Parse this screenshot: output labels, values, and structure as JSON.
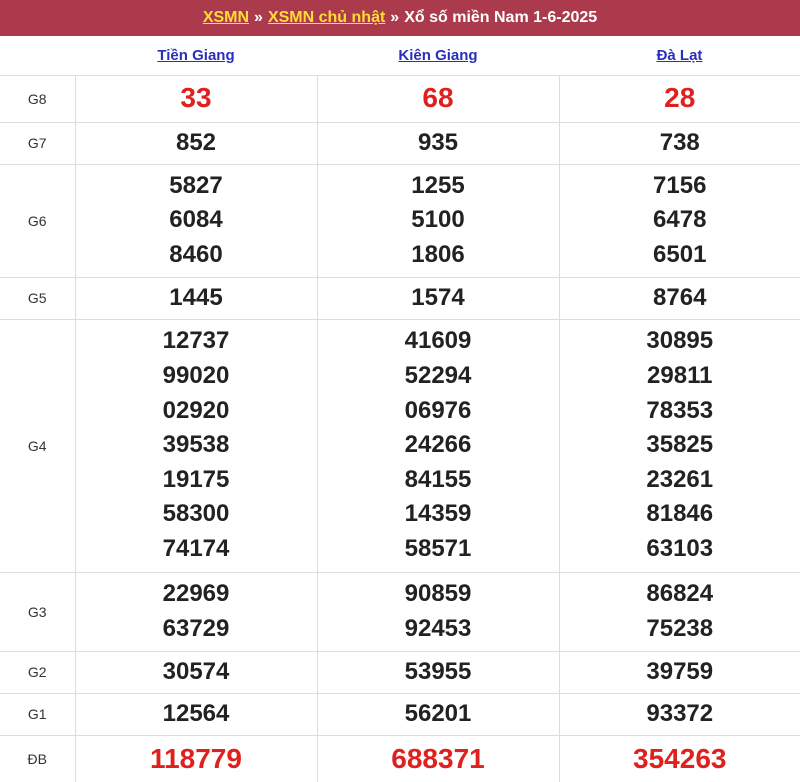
{
  "header": {
    "link1": "XSMN",
    "sep1": "»",
    "link2": "XSMN chủ nhật",
    "sep2": "»",
    "title": "Xổ số miền Nam 1-6-2025"
  },
  "provinces": [
    "Tiền Giang",
    "Kiên Giang",
    "Đà Lạt"
  ],
  "rows": [
    {
      "prize": "G8",
      "values": [
        [
          "33"
        ],
        [
          "68"
        ],
        [
          "28"
        ]
      ]
    },
    {
      "prize": "G7",
      "values": [
        [
          "852"
        ],
        [
          "935"
        ],
        [
          "738"
        ]
      ]
    },
    {
      "prize": "G6",
      "values": [
        [
          "5827",
          "6084",
          "8460"
        ],
        [
          "1255",
          "5100",
          "1806"
        ],
        [
          "7156",
          "6478",
          "6501"
        ]
      ]
    },
    {
      "prize": "G5",
      "values": [
        [
          "1445"
        ],
        [
          "1574"
        ],
        [
          "8764"
        ]
      ]
    },
    {
      "prize": "G4",
      "values": [
        [
          "12737",
          "99020",
          "02920",
          "39538",
          "19175",
          "58300",
          "74174"
        ],
        [
          "41609",
          "52294",
          "06976",
          "24266",
          "84155",
          "14359",
          "58571"
        ],
        [
          "30895",
          "29811",
          "78353",
          "35825",
          "23261",
          "81846",
          "63103"
        ]
      ]
    },
    {
      "prize": "G3",
      "values": [
        [
          "22969",
          "63729"
        ],
        [
          "90859",
          "92453"
        ],
        [
          "86824",
          "75238"
        ]
      ]
    },
    {
      "prize": "G2",
      "values": [
        [
          "30574"
        ],
        [
          "53955"
        ],
        [
          "39759"
        ]
      ]
    },
    {
      "prize": "G1",
      "values": [
        [
          "12564"
        ],
        [
          "56201"
        ],
        [
          "93372"
        ]
      ]
    },
    {
      "prize": "ĐB",
      "values": [
        [
          "118779"
        ],
        [
          "688371"
        ],
        [
          "354263"
        ]
      ]
    }
  ],
  "colors": {
    "header_bg": "#ab3b4c",
    "header_link": "#ffdd33",
    "province_link": "#2a2fbb",
    "highlight_red": "#e0201e"
  }
}
